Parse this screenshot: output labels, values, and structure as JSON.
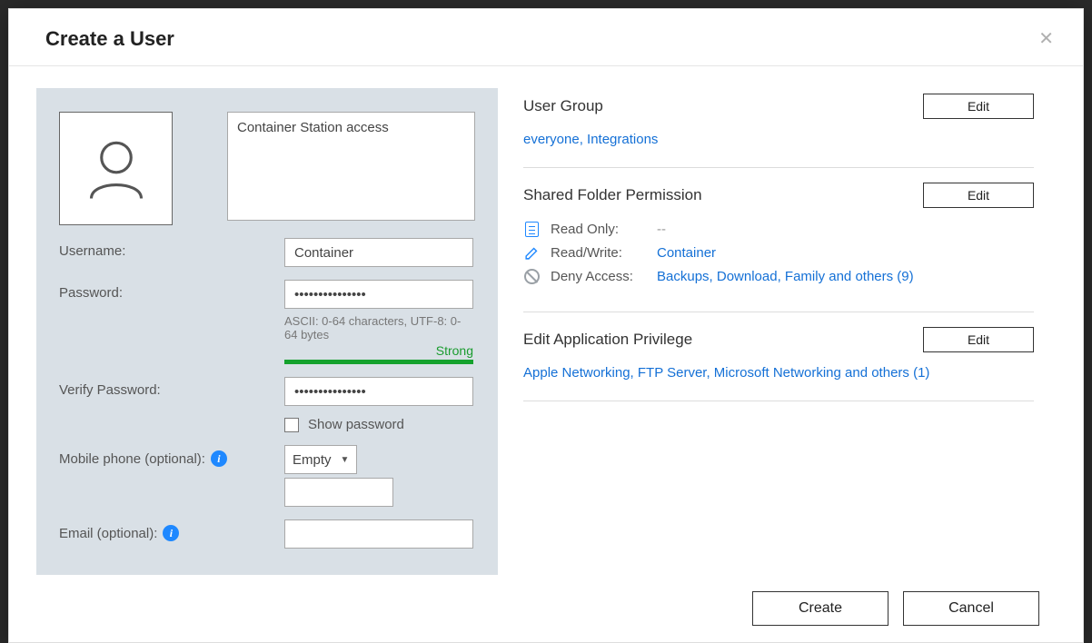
{
  "modal": {
    "title": "Create a User",
    "close_icon": "✕"
  },
  "form": {
    "description_value": "Container Station access",
    "labels": {
      "username": "Username:",
      "password": "Password:",
      "verify_password": "Verify Password:",
      "mobile": "Mobile phone (optional):",
      "email": "Email (optional):"
    },
    "values": {
      "username": "Container",
      "password_mask": "•••••••••••••••",
      "verify_password_mask": "•••••••••••••••",
      "mobile_select": "Empty",
      "mobile_number": "",
      "email": ""
    },
    "password_hint": "ASCII: 0-64 characters, UTF-8: 0-64 bytes",
    "strength_label": "Strong",
    "show_password_label": "Show password"
  },
  "right": {
    "edit_label": "Edit",
    "user_group": {
      "title": "User Group",
      "value": "everyone, Integrations"
    },
    "shared_folder": {
      "title": "Shared Folder Permission",
      "read_only_label": "Read Only:",
      "read_only_value": "--",
      "read_write_label": "Read/Write:",
      "read_write_value": "Container",
      "deny_label": "Deny Access:",
      "deny_value": "Backups, Download, Family and others (9)"
    },
    "app_priv": {
      "title": "Edit Application Privilege",
      "value": "Apple Networking, FTP Server, Microsoft Networking and others (1)"
    }
  },
  "footer": {
    "create": "Create",
    "cancel": "Cancel"
  }
}
